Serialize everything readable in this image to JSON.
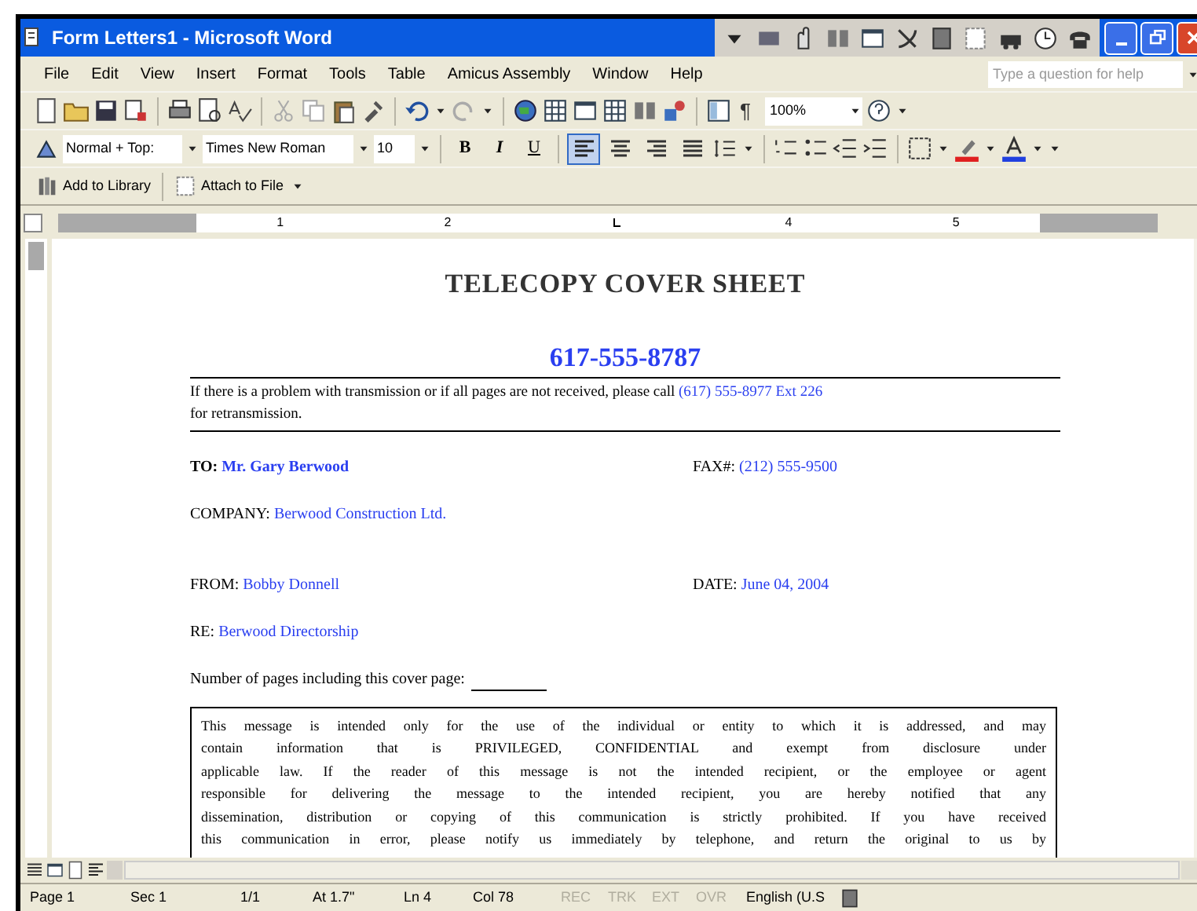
{
  "window": {
    "title": "Form Letters1 - Microsoft Word"
  },
  "menu": {
    "items": [
      "File",
      "Edit",
      "View",
      "Insert",
      "Format",
      "Tools",
      "Table",
      "Amicus Assembly",
      "Window",
      "Help"
    ]
  },
  "help_box": {
    "placeholder": "Type a question for help"
  },
  "standard_toolbar": {
    "pilcrow": "¶",
    "zoom": "100%"
  },
  "formatting_toolbar": {
    "style": "Normal + Top:",
    "font": "Times New Roman",
    "size": "10",
    "bold": "B",
    "italic": "I",
    "underline": "U",
    "alignments": [
      {
        "selected": true
      },
      {
        "selected": false
      },
      {
        "selected": false
      },
      {
        "selected": false
      }
    ]
  },
  "custom_toolbar": {
    "buttons": [
      "Add to Library",
      "Attach to File"
    ]
  },
  "ruler": {
    "marks": [
      {
        "kind": "number",
        "text": "1"
      },
      {
        "kind": "number",
        "text": "2"
      },
      {
        "kind": "tab_stop"
      },
      {
        "kind": "number",
        "text": "4"
      },
      {
        "kind": "number",
        "text": "5"
      }
    ]
  },
  "document": {
    "title": "TELECOPY COVER SHEET",
    "fax_number": "617-555-8787",
    "notice": {
      "text": "If there is a problem with transmission or if all pages are not received, please call",
      "phone": "(617) 555-8977 Ext 226",
      "rest": "for retransmission."
    },
    "rows": [
      [
        {
          "label": "TO:",
          "value": "Mr. Gary Berwood",
          "bold": true
        },
        {
          "label": "FAX#:",
          "value": "(212) 555-9500",
          "bold": false
        }
      ],
      [
        {
          "label": "COMPANY:",
          "value": "Berwood Construction Ltd.",
          "bold": false
        }
      ],
      [
        {
          "label": "FROM:",
          "value": "Bobby Donnell",
          "bold": false
        },
        {
          "label": "DATE:",
          "value": "June 04, 2004",
          "bold": false
        }
      ],
      [
        {
          "label": "RE:",
          "value": "Berwood Directorship",
          "bold": false
        }
      ]
    ],
    "pages_label": "Number of pages including this cover page:",
    "disclaimer": [
      "This message is intended only for the use of the individual or entity to which it is addressed, and may",
      "contain information that is PRIVILEGED, CONFIDENTIAL and exempt from disclosure under",
      "applicable law. If the reader of this message is not the intended recipient, or the employee or agent",
      "responsible for delivering the message to the intended recipient, you are hereby notified that any",
      "dissemination, distribution or copying of this communication is strictly prohibited. If you have received",
      "this communication in error, please notify us immediately by telephone, and return the original to us by"
    ]
  },
  "status_bar": [
    {
      "text": "Page 1",
      "disabled": false
    },
    {
      "text": "Sec 1",
      "disabled": false
    },
    {
      "text": "1/1",
      "disabled": false
    },
    {
      "text": "At 1.7\"",
      "disabled": false
    },
    {
      "text": "Ln 4",
      "disabled": false
    },
    {
      "text": "Col 78",
      "disabled": false
    },
    {
      "text": "REC",
      "disabled": true
    },
    {
      "text": "TRK",
      "disabled": true
    },
    {
      "text": "EXT",
      "disabled": true
    },
    {
      "text": "OVR",
      "disabled": true
    },
    {
      "text": "English (U.S",
      "disabled": false
    }
  ]
}
